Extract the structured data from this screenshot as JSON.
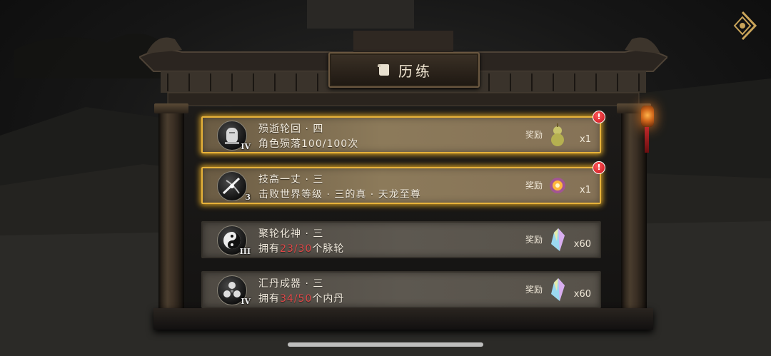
{
  "header": {
    "title": "历练"
  },
  "quests": [
    {
      "title": "殒逝轮回 · 四",
      "desc_prefix": "角色殒落",
      "progress_current": "100",
      "progress_sep": "/",
      "progress_total": "100",
      "desc_suffix": "次",
      "progress_highlight": false,
      "rank": "IV",
      "icon": "tombstone-icon",
      "reward_label": "奖励",
      "reward_icon": "gourd-icon",
      "reward_count": "x1",
      "completed": true,
      "badge": "!"
    },
    {
      "title": "技高一丈 · 三",
      "desc_prefix": "击败世界等级 · 三的真 · 天龙至尊",
      "progress_current": "",
      "progress_sep": "",
      "progress_total": "",
      "desc_suffix": "",
      "progress_highlight": false,
      "rank": "3",
      "icon": "sword-slash-icon",
      "reward_label": "奖励",
      "reward_icon": "glowing-orb-icon",
      "reward_count": "x1",
      "completed": true,
      "badge": "!"
    },
    {
      "title": "聚轮化神 · 三",
      "desc_prefix": "拥有",
      "progress_current": "23",
      "progress_sep": "/",
      "progress_total": "30",
      "desc_suffix": "个脉轮",
      "progress_highlight": true,
      "rank": "III",
      "icon": "yin-yang-icon",
      "reward_label": "奖励",
      "reward_icon": "crystal-icon",
      "reward_count": "x60",
      "completed": false,
      "badge": ""
    },
    {
      "title": "汇丹成器 · 三",
      "desc_prefix": "拥有",
      "progress_current": "34",
      "progress_sep": "/",
      "progress_total": "50",
      "desc_suffix": "个内丹",
      "progress_highlight": true,
      "rank": "IV",
      "icon": "triple-orb-icon",
      "reward_label": "奖励",
      "reward_icon": "crystal-icon",
      "reward_count": "x60",
      "completed": false,
      "badge": ""
    }
  ],
  "colors": {
    "active_border": "#e7b23a",
    "progress_red": "#e04848",
    "text": "#f3ecdf"
  },
  "corner_button": {
    "icon": "diamond-back-icon"
  }
}
